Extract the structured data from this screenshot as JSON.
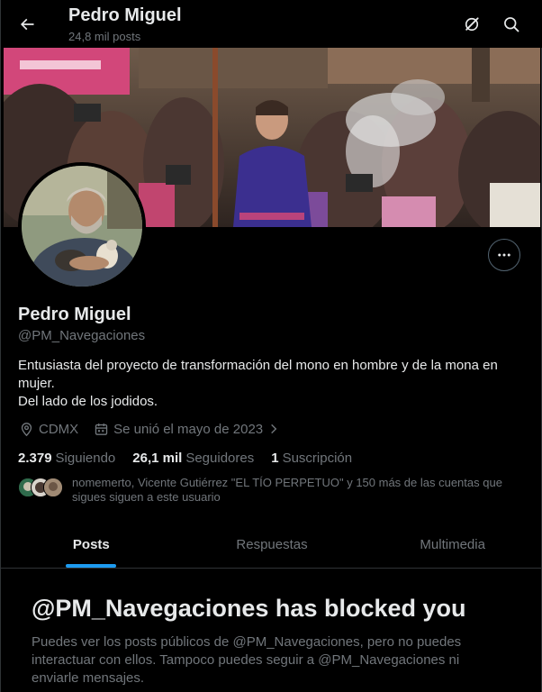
{
  "header": {
    "title": "Pedro Miguel",
    "subtitle": "24,8 mil posts",
    "back_icon": "arrow-left-icon",
    "actions": [
      "grok-icon",
      "search-icon"
    ]
  },
  "profile": {
    "display_name": "Pedro Miguel",
    "handle": "@PM_Navegaciones",
    "bio_lines": [
      "Entusiasta del proyecto de transformación del mono en hombre y de la mona en mujer.",
      "Del lado de los jodidos."
    ],
    "location": "CDMX",
    "joined": "Se unió el mayo de 2023",
    "following": {
      "count": "2.379",
      "label": "Siguiendo"
    },
    "followers": {
      "count": "26,1 mil",
      "label": "Seguidores"
    },
    "subscriptions": {
      "count": "1",
      "label": "Suscripción"
    },
    "followed_by": "nomemerto, Vicente Gutiérrez \"EL TÍO PERPETUO\" y 150 más de las cuentas que sigues siguen a este usuario"
  },
  "tabs": [
    {
      "label": "Posts",
      "active": true
    },
    {
      "label": "Respuestas",
      "active": false
    },
    {
      "label": "Multimedia",
      "active": false
    }
  ],
  "blocked": {
    "title": "@PM_Navegaciones has blocked you",
    "message": "Puedes ver los posts públicos de @PM_Navegaciones, pero no puedes interactuar con ellos. Tampoco puedes seguir a @PM_Navegaciones ni enviarle mensajes."
  },
  "colors": {
    "background": "#000000",
    "text_primary": "#e7e9ea",
    "text_secondary": "#71767b",
    "accent": "#1d9bf0",
    "border": "#2f3336"
  }
}
